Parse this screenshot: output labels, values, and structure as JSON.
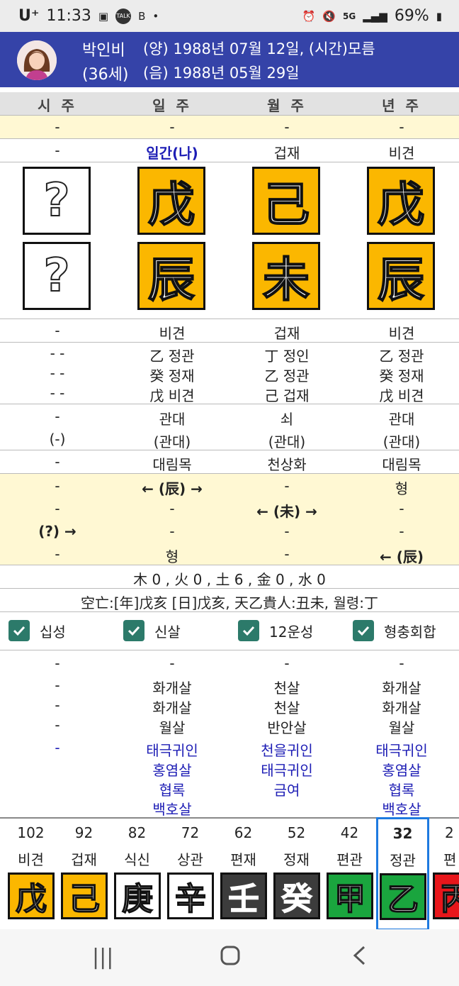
{
  "status": {
    "carrier": "U⁺",
    "time": "11:33",
    "icons_left": [
      "gallery-icon",
      "talk-icon",
      "b-icon",
      "dot"
    ],
    "battery": "69%",
    "net": "5G"
  },
  "header": {
    "name": "박인비",
    "age": "(36세)",
    "solar": "(양) 1988년 07월 12일, (시간)모름",
    "lunar": "(음) 1988년 05월 29일"
  },
  "columns": [
    "시 주",
    "일 주",
    "월 주",
    "년 주"
  ],
  "row_top": [
    "-",
    "-",
    "-",
    "-"
  ],
  "ten_gods_stem": [
    "-",
    "일간(나)",
    "겁재",
    "비견"
  ],
  "stems": [
    "?",
    "戊",
    "己",
    "戊"
  ],
  "branches": [
    "?",
    "辰",
    "未",
    "辰"
  ],
  "ten_gods_branch": [
    "-",
    "비견",
    "겁재",
    "비견"
  ],
  "hidden": [
    [
      "- -",
      "乙 정관",
      "丁 정인",
      "乙 정관"
    ],
    [
      "- -",
      "癸 정재",
      "乙 정관",
      "癸 정재"
    ],
    [
      "- -",
      "戊 비견",
      "己 겁재",
      "戊 비견"
    ]
  ],
  "twelve_stage": [
    "-",
    "관대",
    "쇠",
    "관대"
  ],
  "twelve_stage_paren": [
    "(-)",
    "(관대)",
    "(관대)",
    "(관대)"
  ],
  "nayin": [
    "-",
    "대림목",
    "천상화",
    "대림목"
  ],
  "relations": [
    [
      "-",
      "← (辰) →",
      "-",
      "형"
    ],
    [
      "-",
      "-",
      "← (未) →",
      "-"
    ],
    [
      "(?) →",
      "-",
      "-",
      "-"
    ],
    [
      "-",
      "형",
      "-",
      "← (辰)"
    ]
  ],
  "elements": "木 0 , 火 0 , 土 6 , 金 0 , 水 0",
  "voids": "空亡:[年]戊亥 [日]戊亥, 天乙貴人:丑未, 월령:丁",
  "checkboxes": [
    "십성",
    "신살",
    "12운성",
    "형충회합"
  ],
  "shinsal": [
    [
      "-",
      "-",
      "-",
      "-"
    ],
    [
      "-",
      "화개살",
      "천살",
      "화개살"
    ],
    [
      "-",
      "화개살",
      "천살",
      "화개살"
    ],
    [
      "-",
      "월살",
      "반안살",
      "월살"
    ]
  ],
  "shinsal_blue": [
    [
      "-",
      "태극귀인",
      "천을귀인",
      "태극귀인"
    ],
    [
      "",
      "홍염살",
      "태극귀인",
      "홍염살"
    ],
    [
      "",
      "협록",
      "금여",
      "협록"
    ],
    [
      "",
      "백호살",
      "",
      "백호살"
    ]
  ],
  "strip": [
    {
      "num": "102",
      "label": "비견",
      "char": "戊",
      "bg": "#fbb700",
      "fg": "#fff"
    },
    {
      "num": "92",
      "label": "겁재",
      "char": "己",
      "bg": "#fbb700",
      "fg": "#fff"
    },
    {
      "num": "82",
      "label": "식신",
      "char": "庚",
      "bg": "#ffffff",
      "fg": "#fff"
    },
    {
      "num": "72",
      "label": "상관",
      "char": "辛",
      "bg": "#ffffff",
      "fg": "#fff"
    },
    {
      "num": "62",
      "label": "편재",
      "char": "壬",
      "bg": "#3c3c3c",
      "fg": "#fff"
    },
    {
      "num": "52",
      "label": "정재",
      "char": "癸",
      "bg": "#3c3c3c",
      "fg": "#fff"
    },
    {
      "num": "42",
      "label": "편관",
      "char": "甲",
      "bg": "#1aa53e",
      "fg": "#fff"
    },
    {
      "num": "32",
      "label": "정관",
      "char": "乙",
      "bg": "#1aa53e",
      "fg": "#fff"
    },
    {
      "num": "2",
      "label": "편",
      "char": "丙",
      "bg": "#e8161b",
      "fg": "#fff"
    }
  ]
}
